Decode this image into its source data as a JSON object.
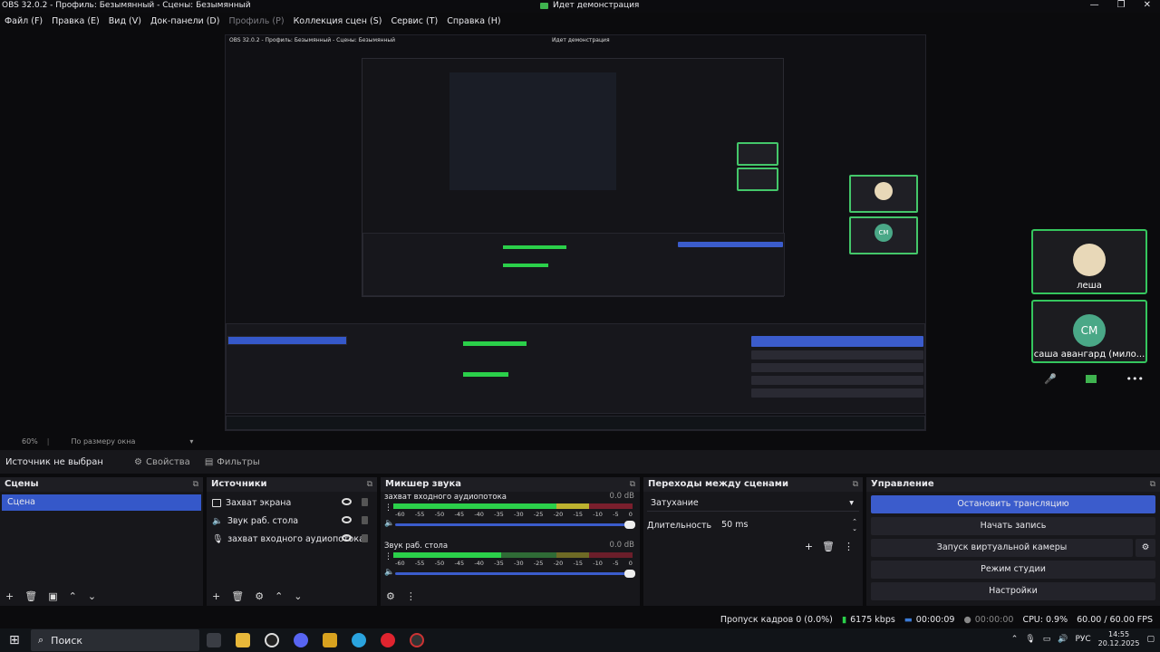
{
  "window": {
    "title": "OBS 32.0.2 - Профиль: Безымянный - Сцены: Безымянный",
    "center_status": "Идет демонстрация",
    "controls": [
      "—",
      "❐",
      "✕"
    ]
  },
  "menu": [
    {
      "label": "Файл (F)",
      "enabled": true
    },
    {
      "label": "Правка (E)",
      "enabled": true
    },
    {
      "label": "Вид (V)",
      "enabled": true
    },
    {
      "label": "Док-панели (D)",
      "enabled": true
    },
    {
      "label": "Профиль (P)",
      "enabled": false
    },
    {
      "label": "Коллекция сцен (S)",
      "enabled": true
    },
    {
      "label": "Сервис (T)",
      "enabled": true
    },
    {
      "label": "Справка (H)",
      "enabled": true
    }
  ],
  "call": {
    "participant1": "леша",
    "participant2": "саша авангард (мило...",
    "initials": "СМ",
    "more": "•••"
  },
  "preview_zoom": {
    "zoom": "60%",
    "mode": "По размеру окна"
  },
  "source_toolbar": {
    "no_source": "Источник не выбран",
    "properties": "Свойства",
    "filters": "Фильтры"
  },
  "scenes": {
    "title": "Сцены",
    "items": [
      "Сцена"
    ]
  },
  "sources": {
    "title": "Источники",
    "items": [
      "Захват экрана",
      "Звук раб. стола",
      "захват входного аудиопотока"
    ]
  },
  "mixer": {
    "title": "Микшер звука",
    "scale": [
      "-60",
      "-55",
      "-50",
      "-45",
      "-40",
      "-35",
      "-30",
      "-25",
      "-20",
      "-15",
      "-10",
      "-5",
      "0"
    ],
    "channels": [
      {
        "name": "захват входного аудиопотока",
        "db": "0.0 dB",
        "level": 0.8
      },
      {
        "name": "Звук раб. стола",
        "db": "0.0 dB",
        "level": 0.45
      }
    ]
  },
  "transitions": {
    "title": "Переходы между сценами",
    "selected": "Затухание",
    "duration_label": "Длительность",
    "duration_value": "50 ms"
  },
  "controls": {
    "title": "Управление",
    "stop_stream": "Остановить трансляцию",
    "start_record": "Начать запись",
    "virtual_cam": "Запуск виртуальной камеры",
    "studio_mode": "Режим студии",
    "settings": "Настройки"
  },
  "status": {
    "dropped": "Пропуск кадров 0 (0.0%)",
    "bitrate": "6175 kbps",
    "stream_time": "00:00:09",
    "rec_time": "00:00:00",
    "cpu": "CPU: 0.9%",
    "fps": "60.00 / 60.00 FPS"
  },
  "taskbar": {
    "search": "Поиск",
    "lang": "РУС",
    "time": "14:55",
    "date": "20.12.2025"
  },
  "colors": {
    "accent": "#3b5ccc",
    "call_border": "#35c65e",
    "meter_green": "#2bd04a"
  }
}
